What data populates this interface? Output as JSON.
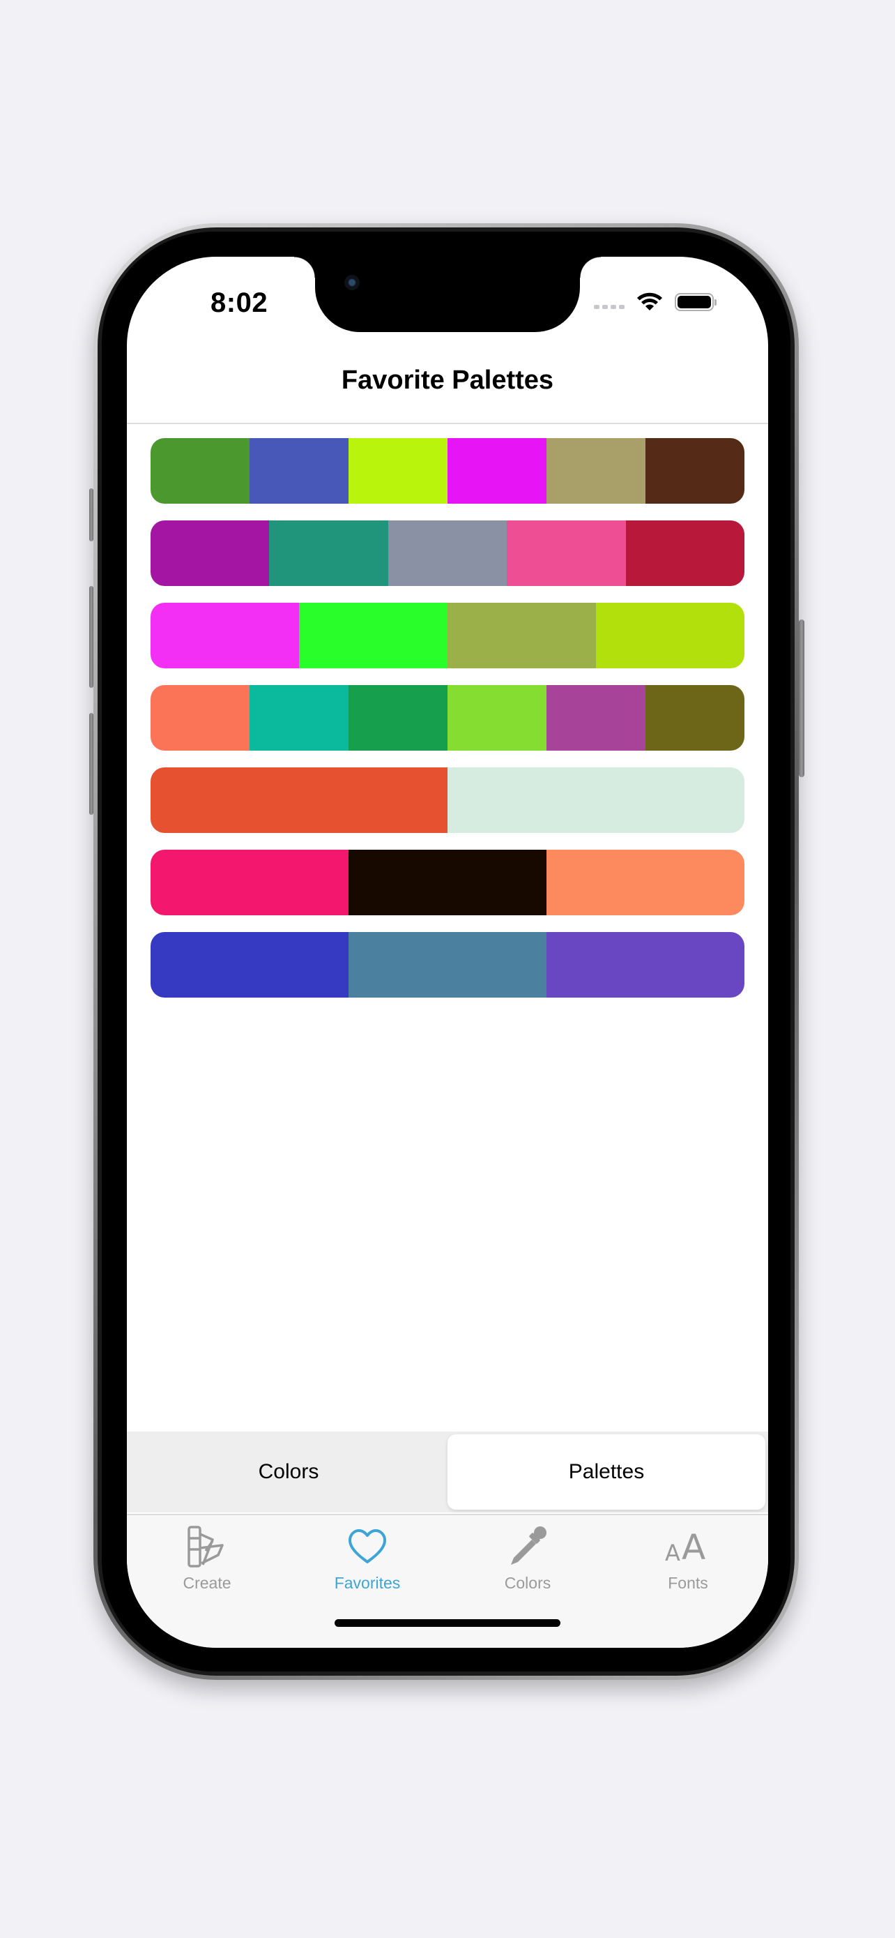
{
  "status_bar": {
    "time": "8:02"
  },
  "nav": {
    "title": "Favorite Palettes"
  },
  "palettes": [
    [
      "#4b982f",
      "#4758b8",
      "#b8f40c",
      "#e715f5",
      "#a99f68",
      "#552a16"
    ],
    [
      "#a515a3",
      "#21957b",
      "#8b91a5",
      "#ee4f94",
      "#b8193a"
    ],
    [
      "#f32ff5",
      "#29fe2b",
      "#9cb04a",
      "#b2e00c"
    ],
    [
      "#fb7458",
      "#0bb99c",
      "#16a04d",
      "#86dd31",
      "#a7449a",
      "#6d6517"
    ],
    [
      "#e65130",
      "#d7ece1"
    ],
    [
      "#f3186e",
      "#170800",
      "#fd8a5f"
    ],
    [
      "#3639c2",
      "#4b819f",
      "#6947c2"
    ]
  ],
  "segmented": {
    "options": [
      "Colors",
      "Palettes"
    ],
    "selected": "Palettes"
  },
  "tabbar": {
    "tabs": [
      {
        "label": "Create",
        "icon": "swatchbook-icon"
      },
      {
        "label": "Favorites",
        "icon": "heart-icon"
      },
      {
        "label": "Colors",
        "icon": "eyedropper-icon"
      },
      {
        "label": "Fonts",
        "icon": "text-size-icon"
      }
    ],
    "active": "Favorites",
    "active_color": "#3ca5d6",
    "inactive_color": "#9a9a9a"
  }
}
